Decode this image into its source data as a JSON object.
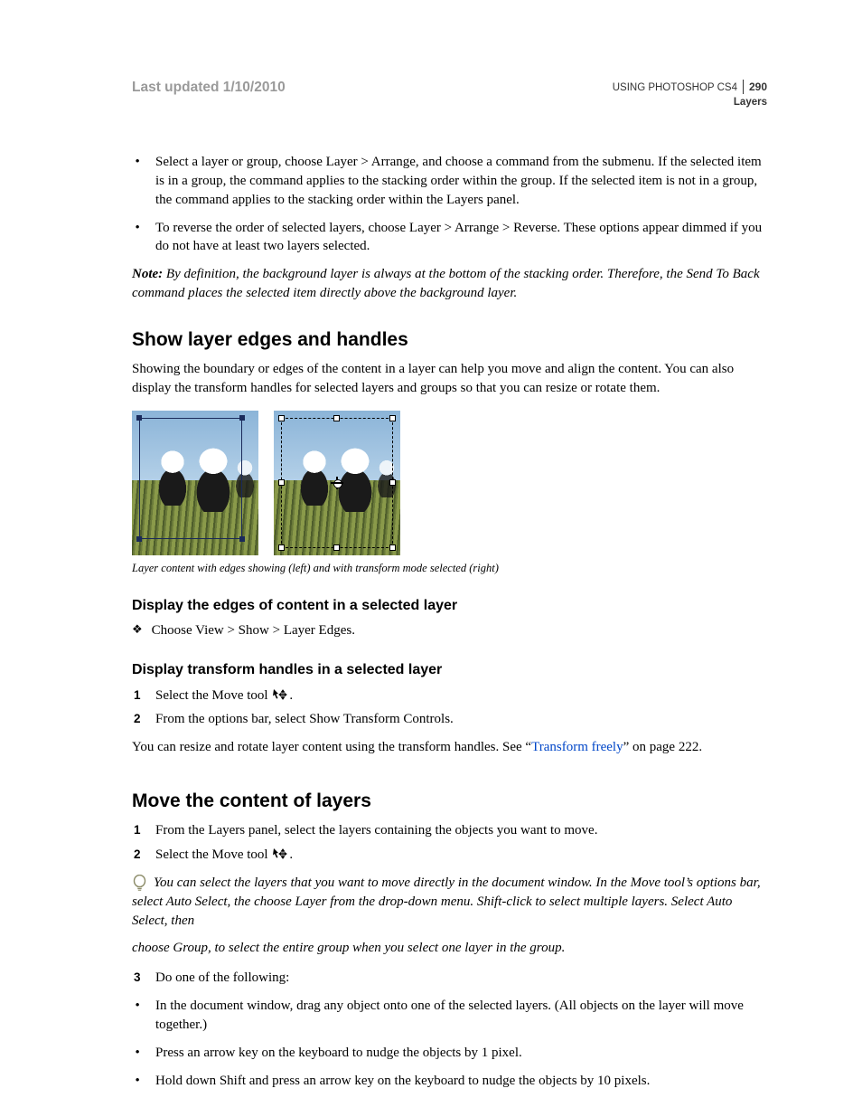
{
  "header": {
    "last_updated": "Last updated 1/10/2010",
    "doc_title": "USING PHOTOSHOP CS4",
    "page_number": "290",
    "section": "Layers"
  },
  "intro_bullets": [
    "Select a layer or group, choose Layer > Arrange, and choose a command from the submenu. If the selected item is in a group, the command applies to the stacking order within the group. If the selected item is not in a group, the command applies to the stacking order within the Layers panel.",
    "To reverse the order of selected layers, choose Layer > Arrange > Reverse. These options appear dimmed if you do not have at least two layers selected."
  ],
  "note": {
    "label": "Note:",
    "text": " By definition, the background layer is always at the bottom of the stacking order. Therefore, the Send To Back command places the selected item directly above the background layer."
  },
  "show_edges": {
    "heading": "Show layer edges and handles",
    "intro": "Showing the boundary or edges of the content in a layer can help you move and align the content. You can also display the transform handles for selected layers and groups so that you can resize or rotate them.",
    "caption": "Layer content with edges showing (left) and with transform mode selected (right)",
    "display_edges_heading": "Display the edges of content in a selected layer",
    "display_edges_step": "Choose View > Show > Layer Edges.",
    "display_transform_heading": "Display transform handles in a selected layer",
    "display_transform_steps": [
      "Select the Move tool ",
      "From the options bar, select Show Transform Controls."
    ],
    "transform_followup_pre": "You can resize and rotate layer content using the transform handles. See “",
    "transform_link": "Transform freely",
    "transform_followup_post": "” on page 222."
  },
  "move_content": {
    "heading": "Move the content of layers",
    "steps_1": "From the Layers panel, select the layers containing the objects you want to move.",
    "steps_2": "Select the Move tool ",
    "tip_line1": "You can select the layers that you want to move directly in the document window. In the Move tool’s options bar, select Auto Select, the choose Layer from the drop-down menu. Shift-click to select multiple layers. Select Auto Select, then",
    "tip_line2": "choose Group, to select the entire group when you select one layer in the group.",
    "steps_3": "Do one of the following:",
    "sub_bullets": [
      "In the document window, drag any object onto one of the selected layers. (All objects on the layer will move together.)",
      "Press an arrow key on the keyboard to nudge the objects by 1 pixel.",
      "Hold down Shift and press an arrow key on the keyboard to nudge the objects by 10 pixels."
    ]
  }
}
